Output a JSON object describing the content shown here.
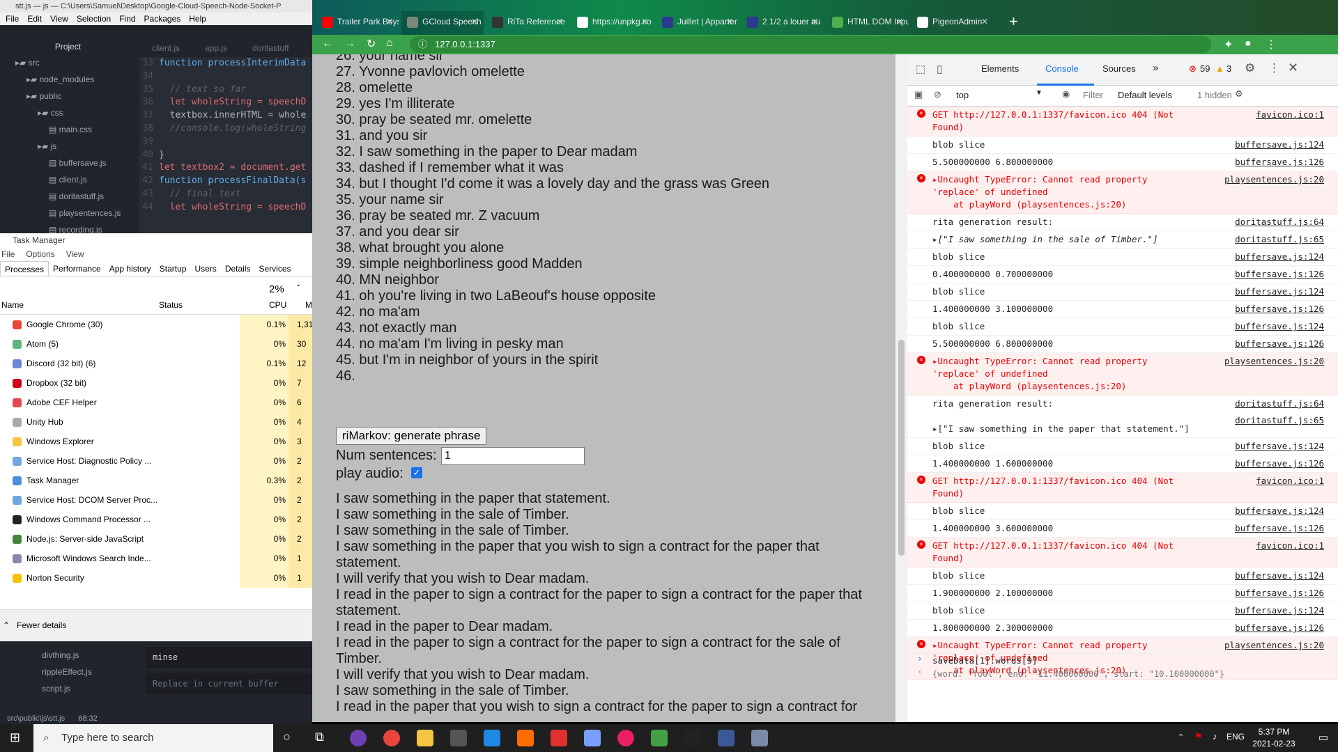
{
  "atom": {
    "title": "stt.js — js — C:\\Users\\Samuel\\Desktop\\Google-Cloud-Speech-Node-Socket-P",
    "menu": [
      "File",
      "Edit",
      "View",
      "Selection",
      "Find",
      "Packages",
      "Help"
    ],
    "project_header": "Project",
    "tree": [
      {
        "label": "src",
        "depth": 0
      },
      {
        "label": "node_modules",
        "depth": 1
      },
      {
        "label": "public",
        "depth": 1
      },
      {
        "label": "css",
        "depth": 2
      },
      {
        "label": "main.css",
        "depth": 3
      },
      {
        "label": "js",
        "depth": 2
      },
      {
        "label": "buffersave.js",
        "depth": 3
      },
      {
        "label": "client.js",
        "depth": 3
      },
      {
        "label": "doritastuff.js",
        "depth": 3
      },
      {
        "label": "playsentences.js",
        "depth": 3
      },
      {
        "label": "recording.js",
        "depth": 3
      }
    ],
    "tabs": [
      "client.js",
      "app.js",
      "doritastuff"
    ],
    "code": [
      {
        "n": "33",
        "t": "function processInterimData"
      },
      {
        "n": "34",
        "t": ""
      },
      {
        "n": "35",
        "t": "  // text so far"
      },
      {
        "n": "36",
        "t": "  let wholeString = speechD"
      },
      {
        "n": "37",
        "t": "  textbox.innerHTML = whole"
      },
      {
        "n": "38",
        "t": "  //console.log(wholeString"
      },
      {
        "n": "39",
        "t": ""
      },
      {
        "n": "40",
        "t": "}"
      },
      {
        "n": "41",
        "t": "let textbox2 = document.get"
      },
      {
        "n": "42",
        "t": "function processFinalData(s"
      },
      {
        "n": "43",
        "t": "  // final text"
      },
      {
        "n": "44",
        "t": "  let wholeString = speechD"
      }
    ],
    "bottom_tree": [
      "divthing.js",
      "rippleEffect.js",
      "script.js"
    ],
    "find_value": "minse",
    "replace_placeholder": "Replace in current buffer",
    "status_path": "src\\public\\js\\stt.js",
    "status_pos": "68:32"
  },
  "taskmgr": {
    "title": "Task Manager",
    "menu": [
      "File",
      "Options",
      "View"
    ],
    "tabs": [
      "Processes",
      "Performance",
      "App history",
      "Startup",
      "Users",
      "Details",
      "Services"
    ],
    "cpu_total": "2%",
    "cols": {
      "name": "Name",
      "status": "Status",
      "cpu": "CPU",
      "mem": "M"
    },
    "rows": [
      {
        "name": "Google Chrome (30)",
        "cpu": "0.1%",
        "mem": "1,31",
        "color": "#e8453c"
      },
      {
        "name": "Atom (5)",
        "cpu": "0%",
        "mem": "30",
        "color": "#5fb57d"
      },
      {
        "name": "Discord (32 bit) (6)",
        "cpu": "0.1%",
        "mem": "12",
        "color": "#6f86d6"
      },
      {
        "name": "Dropbox (32 bit)",
        "cpu": "0%",
        "mem": "7",
        "color": "#d0021b"
      },
      {
        "name": "Adobe CEF Helper",
        "cpu": "0%",
        "mem": "6",
        "color": "#e34850"
      },
      {
        "name": "Unity Hub",
        "cpu": "0%",
        "mem": "4",
        "color": "#aaaaaa"
      },
      {
        "name": "Windows Explorer",
        "cpu": "0%",
        "mem": "3",
        "color": "#f4c542"
      },
      {
        "name": "Service Host: Diagnostic Policy ...",
        "cpu": "0%",
        "mem": "2",
        "color": "#6fa8dc"
      },
      {
        "name": "Task Manager",
        "cpu": "0.3%",
        "mem": "2",
        "color": "#4a90d9"
      },
      {
        "name": "Service Host: DCOM Server Proc...",
        "cpu": "0%",
        "mem": "2",
        "color": "#6fa8dc"
      },
      {
        "name": "Windows Command Processor ...",
        "cpu": "0%",
        "mem": "2",
        "color": "#222222"
      },
      {
        "name": "Node.js: Server-side JavaScript",
        "cpu": "0%",
        "mem": "2",
        "color": "#43853d"
      },
      {
        "name": "Microsoft Windows Search Inde...",
        "cpu": "0%",
        "mem": "1",
        "color": "#8888aa"
      },
      {
        "name": "Norton Security",
        "cpu": "0%",
        "mem": "1",
        "color": "#f5c400"
      }
    ],
    "fewer": "Fewer details"
  },
  "chrome": {
    "tabs": [
      {
        "label": "Trailer Park Boys",
        "color": "#ff0000"
      },
      {
        "label": "GCloud Speech",
        "color": "#7a8a7a"
      },
      {
        "label": "RiTa Reference",
        "color": "#333333"
      },
      {
        "label": "https://unpkg.co",
        "color": "#ffffff"
      },
      {
        "label": "Juillet | Apparter",
        "color": "#2b3990"
      },
      {
        "label": "2 1/2 a louer au",
        "color": "#2b3990"
      },
      {
        "label": "HTML DOM Inpu",
        "color": "#4caf50"
      },
      {
        "label": "PigeonAdmin",
        "color": "#ffffff"
      }
    ],
    "url": "127.0.0.1:1337"
  },
  "page": {
    "lines": [
      "26. your name sir",
      "27. Yvonne pavlovich omelette",
      "28. omelette",
      "29. yes I'm illiterate",
      "30. pray be seated mr. omelette",
      "31. and you sir",
      "32. I saw something in the paper to Dear madam",
      "33. dashed if I remember what it was",
      "34. but I thought I'd come it was a lovely day and the grass was Green",
      "35. your name sir",
      "36. pray be seated mr. Z vacuum",
      "37. and you dear sir",
      "38. what brought you alone",
      "39. simple neighborliness good Madden",
      "40. MN neighbor",
      "41. oh you're living in two LaBeouf's house opposite",
      "42. no ma'am",
      "43. not exactly man",
      "44. no ma'am I'm living in pesky man",
      "45. but I'm in neighbor of yours in the spirit",
      "46."
    ],
    "gen_button": "riMarkov: generate phrase",
    "num_label": "Num sentences:",
    "num_value": "1",
    "audio_label": "play audio:",
    "output": [
      "I saw something in the paper that statement.",
      "I saw something in the sale of Timber.",
      "I saw something in the sale of Timber.",
      "I saw something in the paper that you wish to sign a contract for the paper that statement.",
      "I will verify that you wish to Dear madam.",
      "I read in the paper to sign a contract for the paper to sign a contract for the paper that statement.",
      "I read in the paper to Dear madam.",
      "I read in the paper to sign a contract for the paper to sign a contract for the sale of Timber.",
      "I will verify that you wish to Dear madam.",
      "I saw something in the sale of Timber.",
      "I read in the paper that you wish to sign a contract for the paper to sign a contract for"
    ]
  },
  "devtools": {
    "tabs": [
      "Elements",
      "Console",
      "Sources"
    ],
    "err_count": "59",
    "warn_count": "3",
    "context": "top",
    "filter": "Filter",
    "levels": "Default levels",
    "hidden": "1 hidden",
    "lines": [
      {
        "kind": "err",
        "msg": "GET http://127.0.0.1:1337/favicon.ico 404 (Not\nFound)",
        "src": "favicon.ico:1"
      },
      {
        "kind": "log",
        "msg": "blob slice",
        "src": "buffersave.js:124"
      },
      {
        "kind": "log",
        "msg": "5.500000000 6.800000000",
        "src": "buffersave.js:126"
      },
      {
        "kind": "err",
        "msg": "▸Uncaught TypeError: Cannot read property\n'replace' of undefined\n    at playWord (playsentences.js:20)",
        "src": "playsentences.js:20"
      },
      {
        "kind": "log",
        "msg": "rita generation result:",
        "src": "doritastuff.js:64"
      },
      {
        "kind": "log",
        "msg": "▸[\"I saw something in the sale of Timber.\"]",
        "src": "doritastuff.js:65"
      },
      {
        "kind": "log",
        "msg": "blob slice",
        "src": "buffersave.js:124"
      },
      {
        "kind": "log",
        "msg": "0.400000000 0.700000000",
        "src": "buffersave.js:126"
      },
      {
        "kind": "log",
        "msg": "blob slice",
        "src": "buffersave.js:124"
      },
      {
        "kind": "log",
        "msg": "1.400000000 3.100000000",
        "src": "buffersave.js:126"
      },
      {
        "kind": "log",
        "msg": "blob slice",
        "src": "buffersave.js:124"
      },
      {
        "kind": "log",
        "msg": "5.500000000 6.800000000",
        "src": "buffersave.js:126"
      },
      {
        "kind": "err",
        "msg": "▸Uncaught TypeError: Cannot read property\n'replace' of undefined\n    at playWord (playsentences.js:20)",
        "src": "playsentences.js:20"
      },
      {
        "kind": "log",
        "msg": "rita generation result:\n\n▸[\"I saw something in the paper that statement.\"]",
        "src": "doritastuff.js:64"
      },
      {
        "kind": "log",
        "msg": "blob slice",
        "src": "buffersave.js:124"
      },
      {
        "kind": "log",
        "msg": "1.400000000 1.600000000",
        "src": "buffersave.js:126"
      },
      {
        "kind": "err",
        "msg": "GET http://127.0.0.1:1337/favicon.ico 404 (Not\nFound)",
        "src": "favicon.ico:1"
      },
      {
        "kind": "log",
        "msg": "blob slice",
        "src": "buffersave.js:124"
      },
      {
        "kind": "log",
        "msg": "1.400000000 3.600000000",
        "src": "buffersave.js:126"
      },
      {
        "kind": "err",
        "msg": "GET http://127.0.0.1:1337/favicon.ico 404 (Not\nFound)",
        "src": "favicon.ico:1"
      },
      {
        "kind": "log",
        "msg": "blob slice",
        "src": "buffersave.js:124"
      },
      {
        "kind": "log",
        "msg": "1.900000000 2.100000000",
        "src": "buffersave.js:126"
      },
      {
        "kind": "log",
        "msg": "blob slice",
        "src": "buffersave.js:124"
      },
      {
        "kind": "log",
        "msg": "1.800000000 2.300000000",
        "src": "buffersave.js:126"
      },
      {
        "kind": "err",
        "msg": "▸Uncaught TypeError: Cannot read property\n'replace' of undefined\n    at playWord (playsentences.js:20)",
        "src": "playsentences.js:20"
      }
    ],
    "extra_src": "doritastuff.js:65",
    "prompt": "saveData[1].words[9]",
    "result": "{word: \"fool\", end: \"11.400000000\", start: \"10.100000000\"}"
  },
  "taskbar": {
    "search": "Type here to search",
    "lang": "ENG",
    "time": "5:37 PM",
    "date": "2021-02-23"
  }
}
